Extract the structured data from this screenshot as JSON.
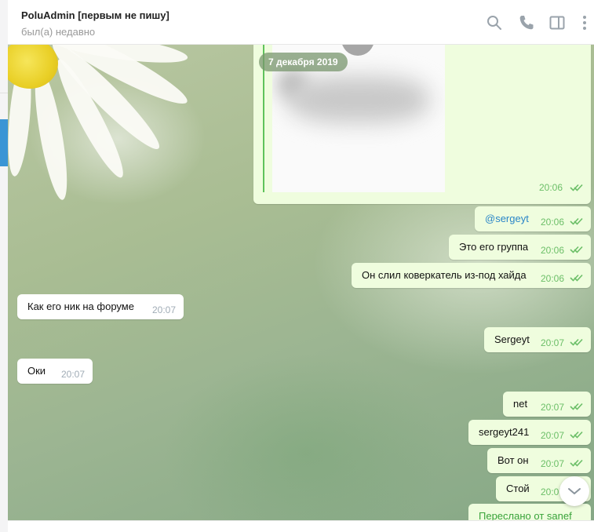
{
  "header": {
    "title": "PoluAdmin [первым не пишу]",
    "status": "был(а) недавно",
    "icons": [
      "search-icon",
      "phone-icon",
      "sidebar-toggle-icon",
      "more-vertical-icon"
    ]
  },
  "chat": {
    "date_label": "7 декабря 2019",
    "media_time": "20:06",
    "messages": [
      {
        "dir": "out",
        "text": "@sergeyt",
        "time": "20:06",
        "mention": true
      },
      {
        "dir": "out",
        "text": "Это его группа",
        "time": "20:06"
      },
      {
        "dir": "out",
        "text": "Он слил коверкатель из-под хайда",
        "time": "20:06"
      },
      {
        "dir": "in",
        "text": "Как его ник на форуме",
        "time": "20:07"
      },
      {
        "dir": "out",
        "text": "Sergeyt",
        "time": "20:07"
      },
      {
        "dir": "in",
        "text": "Оки",
        "time": "20:07"
      },
      {
        "dir": "out",
        "text": "net",
        "time": "20:07"
      },
      {
        "dir": "out",
        "text": "sergeyt241",
        "time": "20:07"
      },
      {
        "dir": "out",
        "text": "Вот он",
        "time": "20:07"
      },
      {
        "dir": "out",
        "text": "Стой",
        "time": "20:07"
      }
    ],
    "forwarded_label": "Переслано от sanef"
  },
  "colors": {
    "accent": "#3a95d5",
    "outgoing_bubble": "#effdde",
    "incoming_bubble": "#ffffff",
    "check_green": "#6cbf68"
  }
}
